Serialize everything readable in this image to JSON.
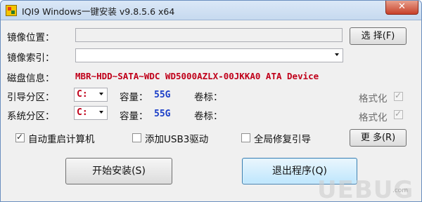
{
  "window": {
    "title": "IQI9 Windows一键安装 v9.8.5.6 x64",
    "close_label": "✕"
  },
  "form": {
    "iso_label": "镜像位置：",
    "iso_value": "",
    "browse_label": "选 择(F)",
    "index_label": "镜像索引：",
    "index_value": "",
    "disk_label": "磁盘信息：",
    "disk_value": "MBR~HDD~SATA~WDC WD5000AZLX-00JKKA0 ATA Device",
    "boot_label": "引导分区：",
    "boot_drive": "C:",
    "boot_capacity_label": "容量：",
    "boot_capacity": "55G",
    "boot_volume_label": "卷标：",
    "boot_format_label": "格式化",
    "boot_format_checked": true,
    "system_label": "系统分区：",
    "system_drive": "C:",
    "system_capacity_label": "容量：",
    "system_capacity": "55G",
    "system_volume_label": "卷标：",
    "system_format_label": "格式化",
    "system_format_checked": true
  },
  "options": {
    "auto_restart_label": "自动重启计算机",
    "auto_restart_checked": true,
    "usb3_label": "添加USB3驱动",
    "usb3_checked": false,
    "repair_boot_label": "全局修复引导",
    "repair_boot_checked": false,
    "more_label": "更 多(R)"
  },
  "actions": {
    "start_label": "开始安装(S)",
    "exit_label": "退出程序(Q)"
  },
  "watermark": {
    "text": "UEBUG",
    "sub": ".com"
  },
  "colors": {
    "disk_info": "#c0001a",
    "capacity": "#1a3ec8",
    "exit_highlight": "#bee6fd"
  }
}
